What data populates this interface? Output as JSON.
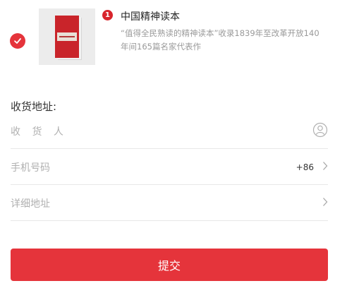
{
  "product": {
    "badge": "1",
    "title": "中国精神读本",
    "description": "“值得全民熟读的精神读本”收录1839年至改革开放140年间165篇名家代表作"
  },
  "address": {
    "section_title": "收货地址:",
    "fields": [
      {
        "label": "收 货 人"
      },
      {
        "label": "手机号码",
        "code": "+86"
      },
      {
        "label": "详细地址"
      }
    ]
  },
  "submit_label": "提交",
  "colors": {
    "accent": "#e5343b"
  },
  "icons": [
    "check-icon",
    "contact-icon",
    "chevron-right-icon"
  ]
}
